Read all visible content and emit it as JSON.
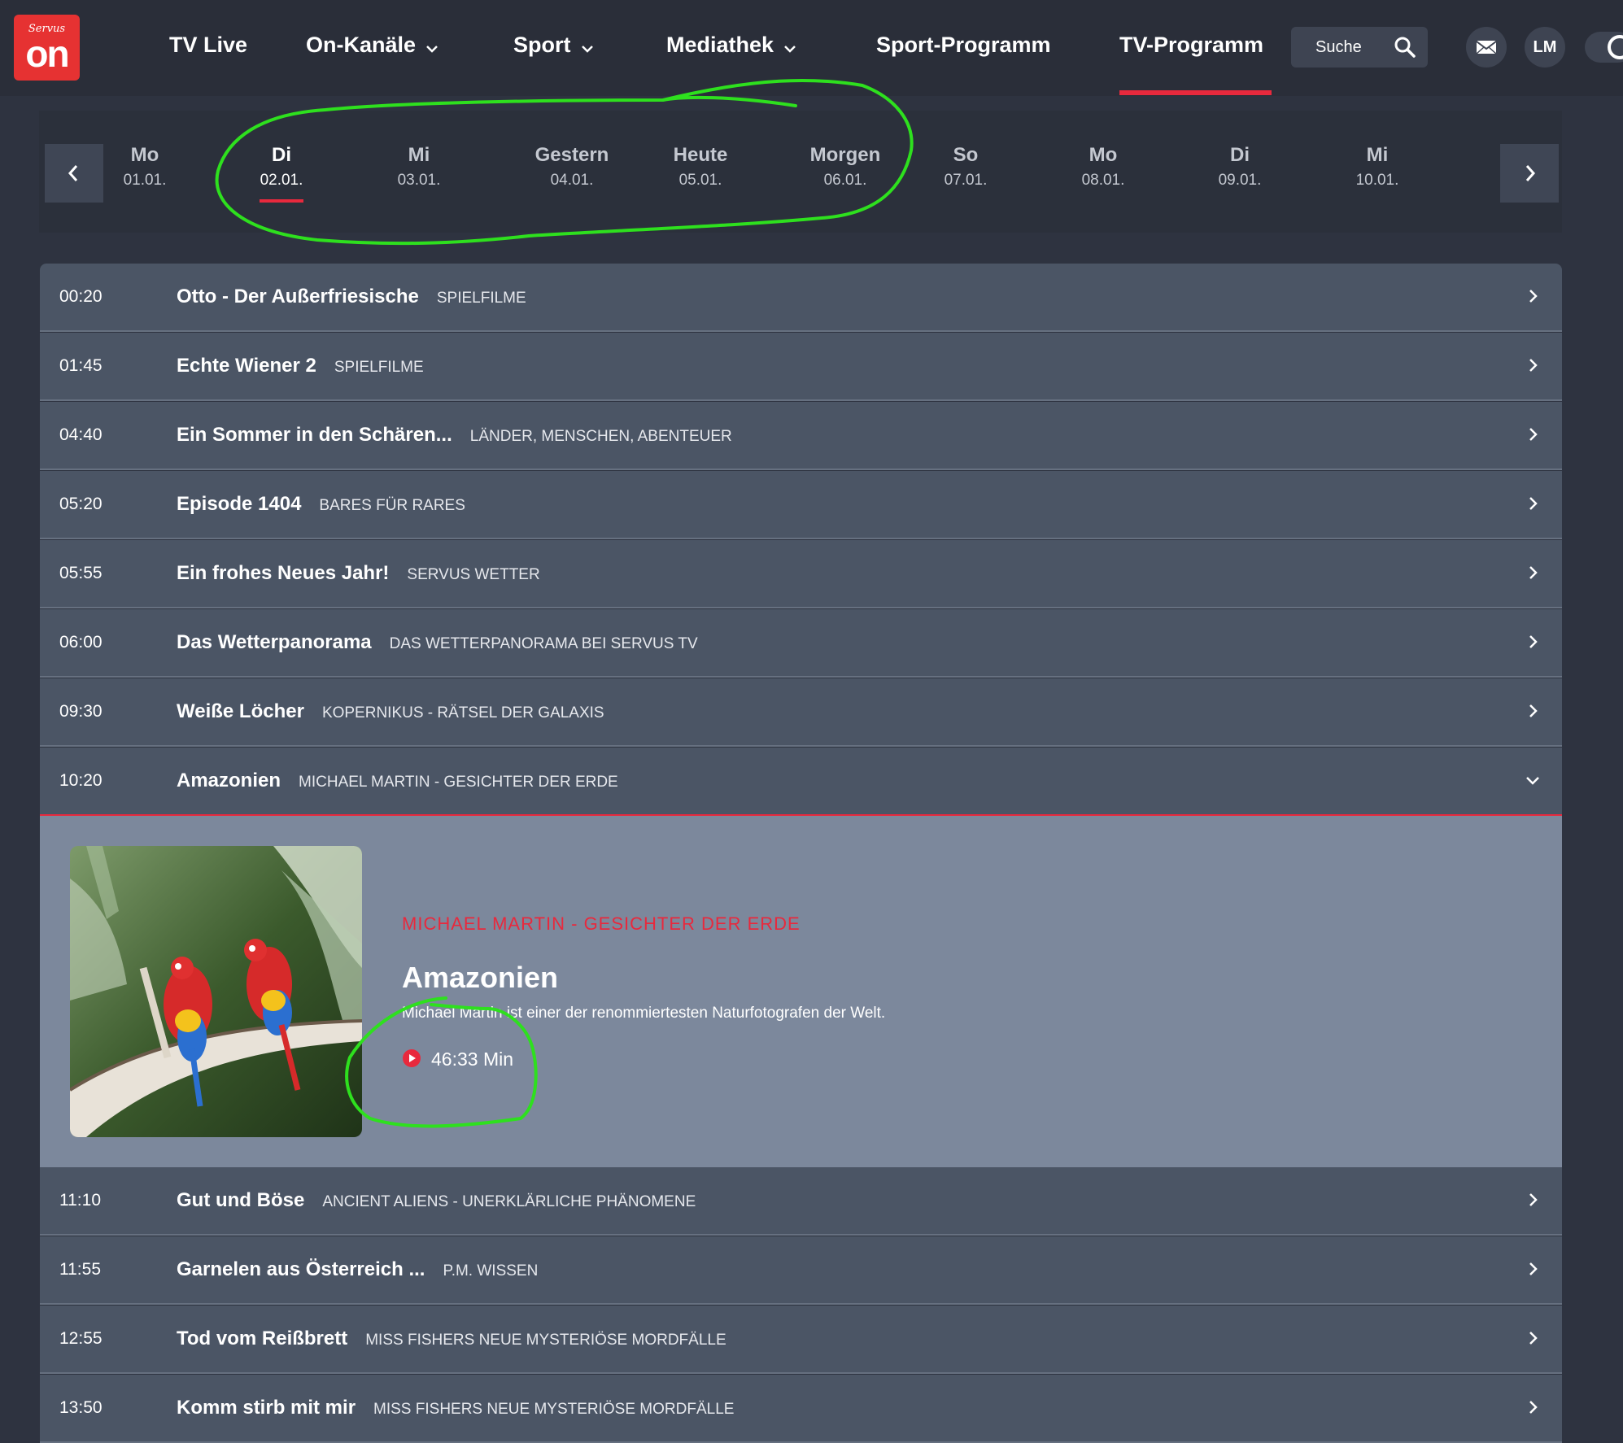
{
  "header": {
    "logo_brand": "Servus",
    "logo_text": "on",
    "nav": [
      {
        "label": "TV Live",
        "has_dropdown": false
      },
      {
        "label": "On-Kanäle",
        "has_dropdown": true
      },
      {
        "label": "Sport",
        "has_dropdown": true
      },
      {
        "label": "Mediathek",
        "has_dropdown": true
      },
      {
        "label": "Sport-Programm",
        "has_dropdown": false
      },
      {
        "label": "TV-Programm",
        "has_dropdown": false,
        "active": true
      }
    ],
    "search_label": "Suche",
    "mail_icon": "mail-icon",
    "avatar": "LM"
  },
  "dates": [
    {
      "day": "Mo",
      "date": "01.01."
    },
    {
      "day": "Di",
      "date": "02.01.",
      "active": true
    },
    {
      "day": "Mi",
      "date": "03.01."
    },
    {
      "day": "Gestern",
      "date": "04.01."
    },
    {
      "day": "Heute",
      "date": "05.01."
    },
    {
      "day": "Morgen",
      "date": "06.01."
    },
    {
      "day": "So",
      "date": "07.01."
    },
    {
      "day": "Mo",
      "date": "08.01."
    },
    {
      "day": "Di",
      "date": "09.01."
    },
    {
      "day": "Mi",
      "date": "10.01."
    }
  ],
  "programs": [
    {
      "time": "00:20",
      "title": "Otto - Der Außerfriesische",
      "category": "SPIELFILME"
    },
    {
      "time": "01:45",
      "title": "Echte Wiener 2",
      "category": "SPIELFILME"
    },
    {
      "time": "04:40",
      "title": "Ein Sommer in den Schären...",
      "category": "LÄNDER, MENSCHEN, ABENTEUER"
    },
    {
      "time": "05:20",
      "title": "Episode 1404",
      "category": "BARES FÜR RARES"
    },
    {
      "time": "05:55",
      "title": "Ein frohes Neues Jahr!",
      "category": "SERVUS WETTER"
    },
    {
      "time": "06:00",
      "title": "Das Wetterpanorama",
      "category": "DAS WETTERPANORAMA BEI SERVUS TV"
    },
    {
      "time": "09:30",
      "title": "Weiße Löcher",
      "category": "KOPERNIKUS - RÄTSEL DER GALAXIS"
    },
    {
      "time": "10:20",
      "title": "Amazonien",
      "category": "MICHAEL MARTIN - GESICHTER DER ERDE",
      "expanded": true
    },
    {
      "time": "11:10",
      "title": "Gut und Böse",
      "category": "ANCIENT ALIENS - UNERKLÄRLICHE PHÄNOMENE"
    },
    {
      "time": "11:55",
      "title": "Garnelen aus Österreich ...",
      "category": "P.M. WISSEN"
    },
    {
      "time": "12:55",
      "title": "Tod vom Reißbrett",
      "category": "MISS FISHERS NEUE MYSTERIÖSE MORDFÄLLE"
    },
    {
      "time": "13:50",
      "title": "Komm stirb mit mir",
      "category": "MISS FISHERS NEUE MYSTERIÖSE MORDFÄLLE"
    }
  ],
  "detail": {
    "subtitle": "MICHAEL MARTIN - GESICHTER DER ERDE",
    "title": "Amazonien",
    "description": "Michael Martin ist einer der renommiertesten Naturfotografen der Welt.",
    "duration": "46:33 Min",
    "image": "two-scarlet-macaws-on-branch"
  },
  "colors": {
    "accent": "#e8293d",
    "annotation": "#2ee01e",
    "background": "#2e3340",
    "row": "#4b5565",
    "detail": "#7c889c"
  }
}
